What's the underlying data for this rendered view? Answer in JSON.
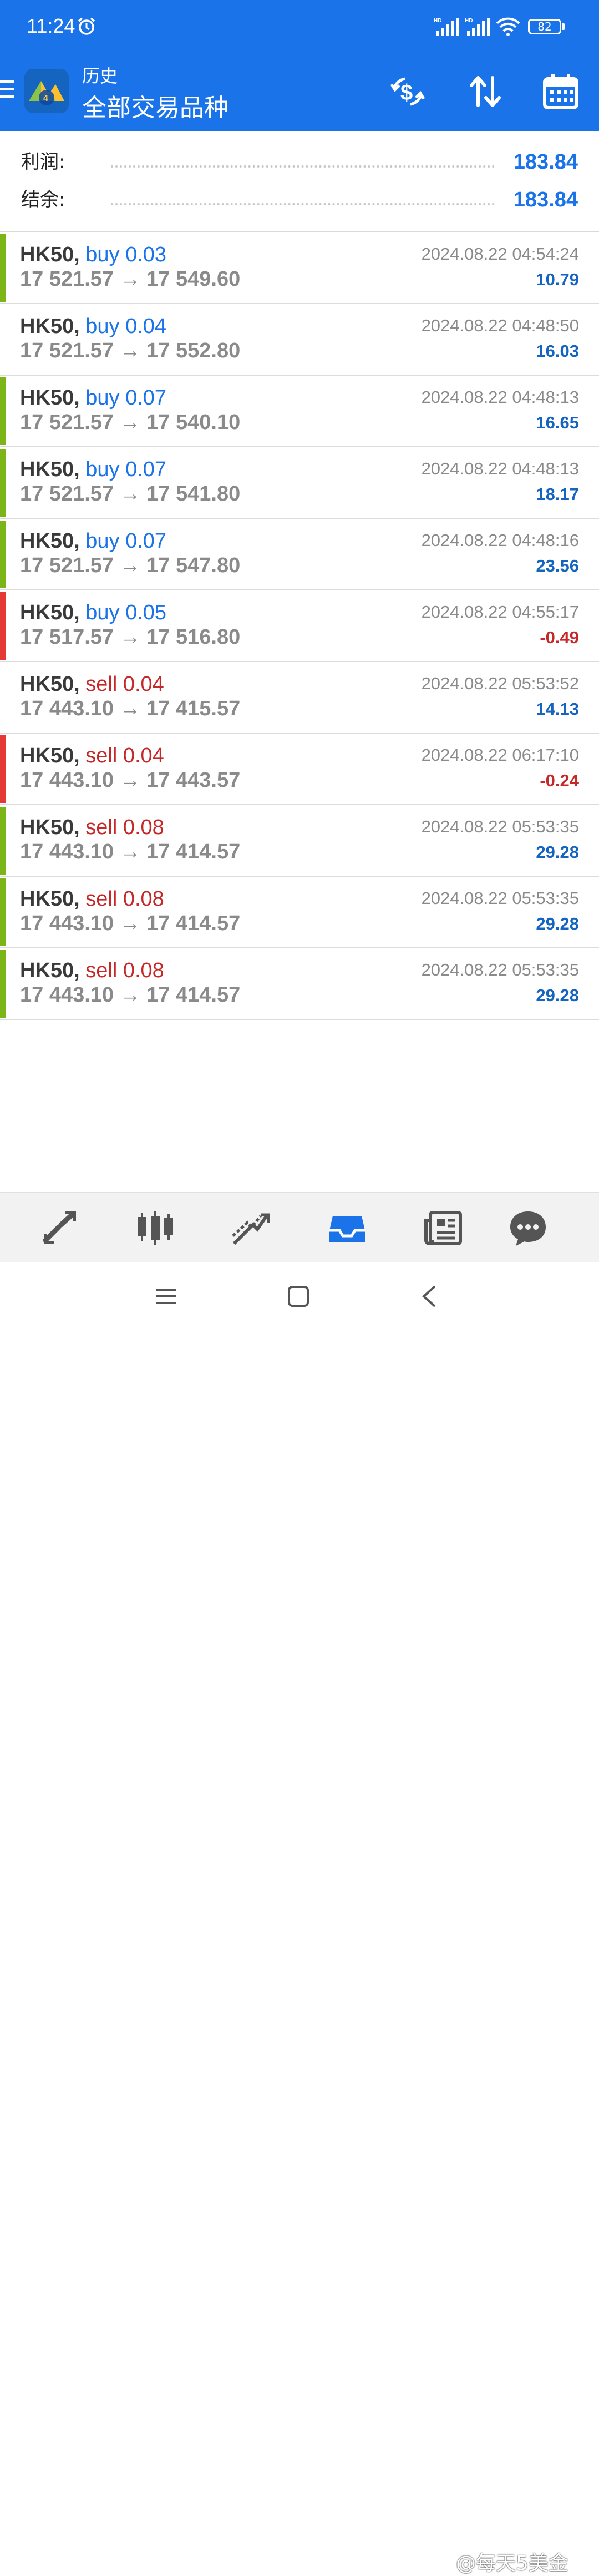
{
  "status": {
    "time": "11:24",
    "battery": "82"
  },
  "header": {
    "title": "历史",
    "subtitle": "全部交易品种"
  },
  "summary": [
    {
      "label": "利润:",
      "value": "183.84"
    },
    {
      "label": "结余:",
      "value": "183.84"
    }
  ],
  "colors": {
    "accent": "#1a73e8",
    "buy": "#1a73e8",
    "sell": "#c62828",
    "positive": "#1565c0",
    "negative": "#c62828",
    "bar_green": "#7cb518",
    "bar_red": "#e53935"
  },
  "trades": [
    {
      "symbol": "HK50,",
      "action": "buy 0.03",
      "side": "buy",
      "prices": "17 521.57 → 17 549.60",
      "time": "2024.08.22 04:54:24",
      "profit": "10.79",
      "bar": "green"
    },
    {
      "symbol": "HK50,",
      "action": "buy 0.04",
      "side": "buy",
      "prices": "17 521.57 → 17 552.80",
      "time": "2024.08.22 04:48:50",
      "profit": "16.03",
      "bar": "none"
    },
    {
      "symbol": "HK50,",
      "action": "buy 0.07",
      "side": "buy",
      "prices": "17 521.57 → 17 540.10",
      "time": "2024.08.22 04:48:13",
      "profit": "16.65",
      "bar": "green"
    },
    {
      "symbol": "HK50,",
      "action": "buy 0.07",
      "side": "buy",
      "prices": "17 521.57 → 17 541.80",
      "time": "2024.08.22 04:48:13",
      "profit": "18.17",
      "bar": "green"
    },
    {
      "symbol": "HK50,",
      "action": "buy 0.07",
      "side": "buy",
      "prices": "17 521.57 → 17 547.80",
      "time": "2024.08.22 04:48:16",
      "profit": "23.56",
      "bar": "green"
    },
    {
      "symbol": "HK50,",
      "action": "buy 0.05",
      "side": "buy",
      "prices": "17 517.57 → 17 516.80",
      "time": "2024.08.22 04:55:17",
      "profit": "-0.49",
      "bar": "red"
    },
    {
      "symbol": "HK50,",
      "action": "sell 0.04",
      "side": "sell",
      "prices": "17 443.10 → 17 415.57",
      "time": "2024.08.22 05:53:52",
      "profit": "14.13",
      "bar": "none"
    },
    {
      "symbol": "HK50,",
      "action": "sell 0.04",
      "side": "sell",
      "prices": "17 443.10 → 17 443.57",
      "time": "2024.08.22 06:17:10",
      "profit": "-0.24",
      "bar": "red"
    },
    {
      "symbol": "HK50,",
      "action": "sell 0.08",
      "side": "sell",
      "prices": "17 443.10 → 17 414.57",
      "time": "2024.08.22 05:53:35",
      "profit": "29.28",
      "bar": "green"
    },
    {
      "symbol": "HK50,",
      "action": "sell 0.08",
      "side": "sell",
      "prices": "17 443.10 → 17 414.57",
      "time": "2024.08.22 05:53:35",
      "profit": "29.28",
      "bar": "green"
    },
    {
      "symbol": "HK50,",
      "action": "sell 0.08",
      "side": "sell",
      "prices": "17 443.10 → 17 414.57",
      "time": "2024.08.22 05:53:35",
      "profit": "29.28",
      "bar": "green"
    }
  ],
  "tabs": [
    {
      "name": "quotes-icon",
      "active": false
    },
    {
      "name": "chart-icon",
      "active": false
    },
    {
      "name": "trade-icon",
      "active": false
    },
    {
      "name": "history-icon",
      "active": true
    },
    {
      "name": "news-icon",
      "active": false
    },
    {
      "name": "chat-icon",
      "active": false
    }
  ],
  "watermark": "@每天5美金"
}
